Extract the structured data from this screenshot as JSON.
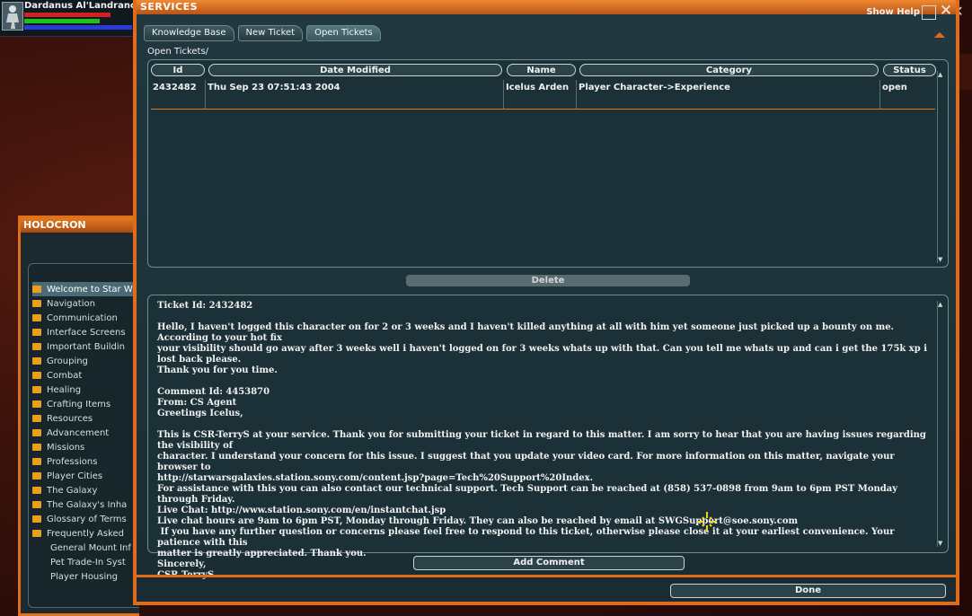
{
  "player": {
    "name": "Dardanus Al'Landranoris",
    "health_fraction": 0.8,
    "action_fraction": 0.7,
    "mind_fraction": 1.0
  },
  "holocron": {
    "title": "HOLOCRON",
    "items": [
      {
        "label": "Welcome to Star W",
        "selected": true,
        "folder": true
      },
      {
        "label": "Navigation",
        "folder": true
      },
      {
        "label": "Communication",
        "folder": true
      },
      {
        "label": "Interface Screens",
        "folder": true
      },
      {
        "label": "Important Buildin",
        "folder": true
      },
      {
        "label": "Grouping",
        "folder": true
      },
      {
        "label": "Combat",
        "folder": true
      },
      {
        "label": "Healing",
        "folder": true
      },
      {
        "label": "Crafting Items",
        "folder": true
      },
      {
        "label": "Resources",
        "folder": true
      },
      {
        "label": "Advancement",
        "folder": true
      },
      {
        "label": "Missions",
        "folder": true
      },
      {
        "label": "Professions",
        "folder": true
      },
      {
        "label": "Player Cities",
        "folder": true
      },
      {
        "label": "The Galaxy",
        "folder": true
      },
      {
        "label": "The Galaxy's Inha",
        "folder": true
      },
      {
        "label": "Glossary of Terms",
        "folder": true
      },
      {
        "label": "Frequently Asked",
        "folder": true
      },
      {
        "label": "General Mount Inf",
        "folder": false
      },
      {
        "label": "Pet Trade-In Syst",
        "folder": false
      },
      {
        "label": "Player Housing",
        "folder": false
      }
    ]
  },
  "services": {
    "title": "SERVICES",
    "show_help": "Show Help",
    "close_glyph": "✕",
    "tabs": [
      "Knowledge Base",
      "New Ticket",
      "Open Tickets"
    ],
    "active_tab": "Open Tickets",
    "breadcrumb": "Open Tickets/",
    "columns": [
      "Id",
      "Date Modified",
      "Name",
      "Category",
      "Status"
    ],
    "tickets": [
      {
        "id": "2432482",
        "date_modified": "Thu Sep 23 07:51:43 2004",
        "name": "Icelus Arden",
        "category": "Player Character->Experience",
        "status": "open"
      }
    ],
    "delete_label": "Delete",
    "add_comment_label": "Add Comment",
    "done_label": "Done",
    "message": "Ticket Id: 2432482\n\nHello, I haven't logged this character on for 2 or 3 weeks and I haven't killed anything at all with him yet someone just picked up a bounty on me. According to your hot fix\nyour visibility should go away after 3 weeks well i haven't logged on for 3 weeks whats up with that. Can you tell me whats up and can i get the 175k xp i lost back please.\nThank you for you time.\n\nComment Id: 4453870\nFrom: CS Agent\nGreetings Icelus,\n\nThis is CSR-TerryS at your service. Thank you for submitting your ticket in regard to this matter. I am sorry to hear that you are having issues regarding the visibility of\ncharacter. I understand your concern for this issue. I suggest that you update your video card. For more information on this matter, navigate your browser to\nhttp://starwarsgalaxies.station.sony.com/content.jsp?page=Tech%20Support%20Index.\nFor assistance with this you can also contact our technical support. Tech Support can be reached at (858) 537-0898 from 9am to 6pm PST Monday through Friday.\nLive Chat: http://www.station.sony.com/en/instantchat.jsp\nLive chat hours are 9am to 6pm PST, Monday through Friday. They can also be reached by email at SWGSupport@soe.sony.com\n If you have any further question or concerns please feel free to respond to this ticket, otherwise please close it at your earliest convenience. Your patience with this\nmatter is greatly appreciated. Thank you.\nSincerely,\nCSR TerryS"
  },
  "colors": {
    "frame_orange": "#e06b1a",
    "panel_teal": "#1c3137",
    "crosshair_yellow": "#f0d020"
  }
}
